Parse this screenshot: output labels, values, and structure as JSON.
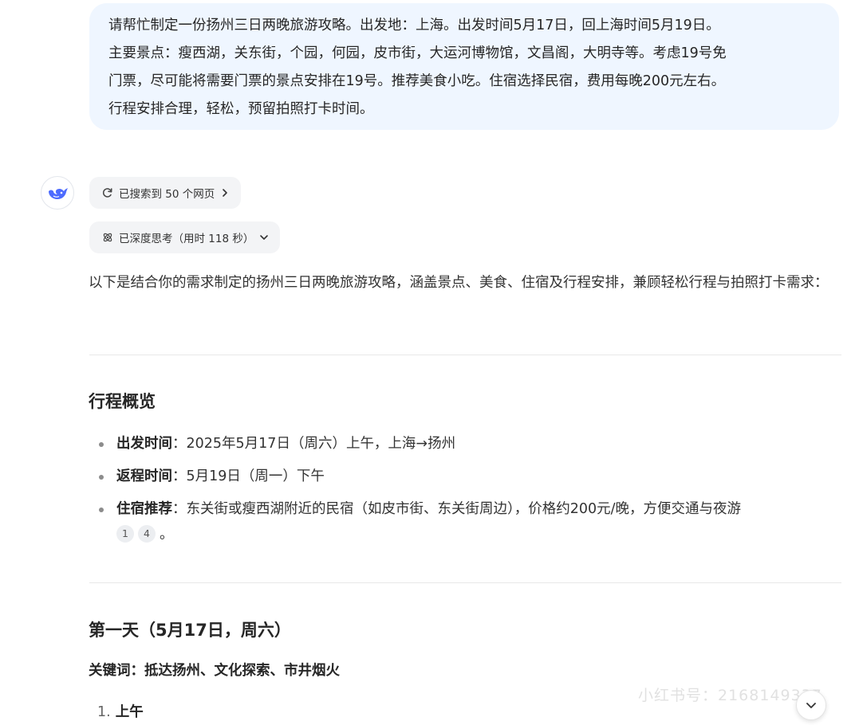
{
  "user_message": {
    "lines": [
      "请帮忙制定一份扬州三日两晚旅游攻略。出发地：上海。出发时间5月17日，回上海时间5月19日。",
      "主要景点：瘦西湖，关东街，个园，何园，皮市街，大运河博物馆，文昌阁，大明寺等。考虑19号免",
      "门票，尽可能将需要门票的景点安排在19号。推荐美食小吃。住宿选择民宿，费用每晚200元左右。",
      "行程安排合理，轻松，预留拍照打卡时间。"
    ]
  },
  "assistant": {
    "search_label": "已搜索到 50 个网页",
    "think_label": "已深度思考（用时 118 秒）",
    "intro": "以下是结合你的需求制定的扬州三日两晚旅游攻略，涵盖景点、美食、住宿及行程安排，兼顾轻松行程与拍照打卡需求：",
    "overview_heading": "行程概览",
    "overview": [
      {
        "label": "出发时间",
        "text": "：2025年5月17日（周六）上午，上海→扬州",
        "citations": []
      },
      {
        "label": "返程时间",
        "text": "：5月19日（周一）下午",
        "citations": []
      },
      {
        "label": "住宿推荐",
        "text": "：东关街或瘦西湖附近的民宿（如皮市街、东关街周边），价格约200元/晚，方便交通与夜游",
        "citations": [
          "1",
          "4"
        ],
        "tail": "。"
      }
    ],
    "day1_heading": "第一天（5月17日，周六）",
    "day1_keywords": "关键词：抵达扬州、文化探索、市井烟火",
    "day1_list": [
      {
        "num": "1.",
        "label": "上午"
      }
    ]
  },
  "watermark": "小红书号：2168149337",
  "icons": {
    "avatar": "whale-logo-icon",
    "search": "search-refresh-icon",
    "think": "atom-icon",
    "chevron_right": "chevron-right-icon",
    "chevron_down": "chevron-down-icon",
    "scroll": "scroll-down-icon"
  },
  "colors": {
    "brand": "#4d6bfe",
    "bubble": "#eff6ff"
  }
}
